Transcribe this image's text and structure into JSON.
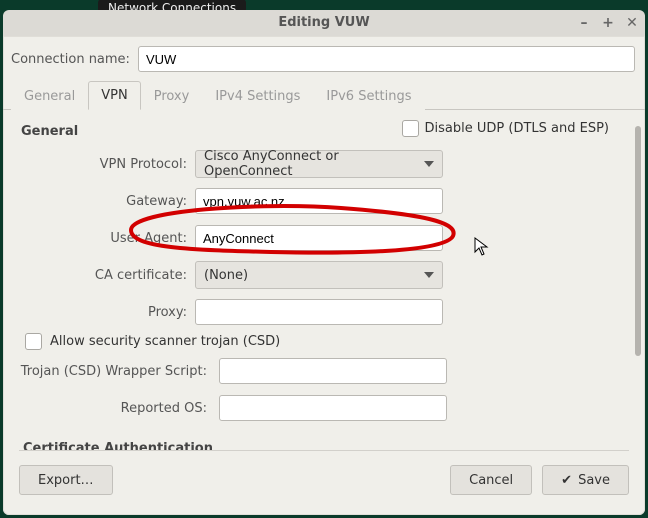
{
  "badge": "Network Connections",
  "window": {
    "title": "Editing VUW"
  },
  "connection": {
    "name_label": "Connection name:",
    "name_value": "VUW"
  },
  "tabs": {
    "general": "General",
    "vpn": "VPN",
    "proxy": "Proxy",
    "ipv4": "IPv4 Settings",
    "ipv6": "IPv6 Settings"
  },
  "vpn": {
    "section_general": "General",
    "disable_udp": "Disable UDP (DTLS and ESP)",
    "labels": {
      "protocol": "VPN Protocol:",
      "gateway": "Gateway:",
      "user_agent": "User Agent:",
      "ca_cert": "CA certificate:",
      "proxy": "Proxy:",
      "allow_csd": "Allow security scanner trojan (CSD)",
      "csd_wrapper": "Trojan (CSD) Wrapper Script:",
      "reported_os": "Reported OS:"
    },
    "values": {
      "protocol": "Cisco AnyConnect or OpenConnect",
      "gateway": "vpn.vuw.ac.nz",
      "user_agent": "AnyConnect",
      "ca_cert": "(None)",
      "proxy": "",
      "csd_wrapper": "",
      "reported_os": ""
    },
    "section_cert": "Certificate Authentication"
  },
  "footer": {
    "export": "Export…",
    "cancel": "Cancel",
    "save": "Save"
  }
}
